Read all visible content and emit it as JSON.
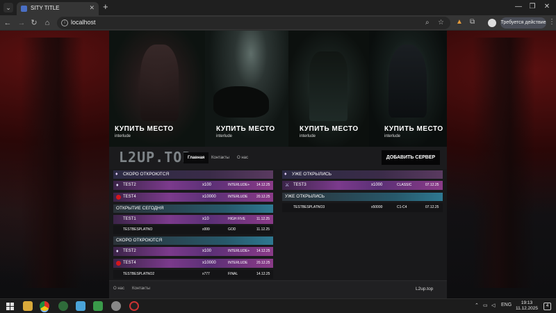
{
  "browser": {
    "tab_title": "SITY TITLE",
    "url": "localhost",
    "action_label": "Требуется действие",
    "tab_menu_icon": "chevron-down-icon",
    "new_tab_icon": "plus-icon"
  },
  "banner": {
    "slots": [
      {
        "caption": "КУПИТЬ МЕСТО",
        "subtitle": "interlude"
      },
      {
        "caption": "КУПИТЬ МЕСТО",
        "subtitle": "interlude"
      },
      {
        "caption": "КУПИТЬ МЕСТО",
        "subtitle": "interlude"
      },
      {
        "caption": "КУПИТЬ МЕСТО",
        "subtitle": "interlude"
      }
    ]
  },
  "nav": {
    "logo": "L2UP.TOP",
    "links": [
      "Главная",
      "Контакты",
      "О нас"
    ],
    "add_server": "ДОБАВИТЬ СЕРВЕР"
  },
  "left": {
    "soon_header": "СКОРО ОТКРОЮТСЯ",
    "soon_rows": [
      {
        "name": "TEST2",
        "rate": "x100",
        "chronicle": "INTERLUDE+",
        "date": "14.12.25",
        "icon": "gem-icon"
      },
      {
        "name": "TEST4",
        "rate": "x10000",
        "chronicle": "INTERLUDE",
        "date": "20.12.25",
        "icon": "red-circle-icon"
      }
    ],
    "today_header": "ОТКРЫТИЕ СЕГОДНЯ",
    "today_rows": [
      {
        "name": "TEST1",
        "rate": "x10",
        "chronicle": "HIGH FIVE",
        "date": "11.12.25"
      },
      {
        "name": "TESTBESPLATNO",
        "rate": "x999",
        "chronicle": "GOD",
        "date": "11.12.25"
      }
    ],
    "soon2_header": "СКОРО ОТКРОЮТСЯ",
    "soon2_rows": [
      {
        "name": "TEST2",
        "rate": "x100",
        "chronicle": "INTERLUDE+",
        "date": "14.12.25",
        "icon": "gem-icon"
      },
      {
        "name": "TEST4",
        "rate": "x10000",
        "chronicle": "INTERLUDE",
        "date": "20.12.25",
        "icon": "red-circle-icon"
      },
      {
        "name": "TESTBESPLATNO2",
        "rate": "x777",
        "chronicle": "FINAL",
        "date": "14.12.25"
      }
    ]
  },
  "right": {
    "opened_header": "УЖЕ ОТКРЫЛИСЬ",
    "opened_rows": [
      {
        "name": "TEST3",
        "rate": "x1000",
        "chronicle": "CLASSIC",
        "date": "07.12.25",
        "icon": "sword-icon"
      }
    ],
    "opened2_header": "УЖЕ ОТКРЫЛИСЬ",
    "opened2_rows": [
      {
        "name": "TESTBESPLATNO3",
        "rate": "x50000",
        "chronicle": "C1-C4",
        "date": "07.12.25"
      }
    ]
  },
  "footer": {
    "links": [
      "О нас",
      "Контакты"
    ],
    "brand": "L2up.top"
  },
  "taskbar": {
    "lang": "ENG",
    "time": "19:13",
    "date": "11.12.2025",
    "notifications": "4"
  }
}
